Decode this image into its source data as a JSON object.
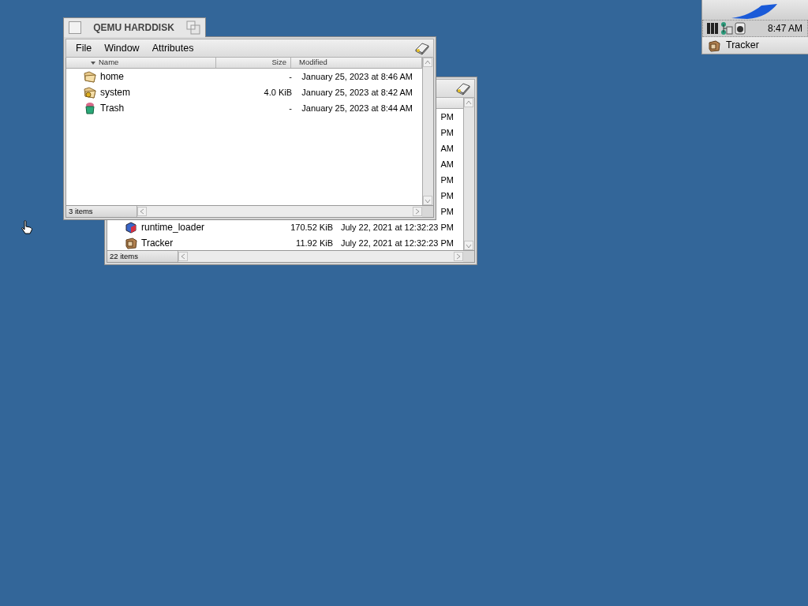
{
  "deskbar": {
    "clock": "8:47 AM",
    "apps": [
      {
        "label": "Tracker",
        "kind": "tracker"
      }
    ]
  },
  "back_window": {
    "rows": [
      {
        "modified": "PM"
      },
      {
        "modified": "PM"
      },
      {
        "modified": "AM"
      },
      {
        "modified": "AM"
      },
      {
        "modified": "PM"
      },
      {
        "modified": "PM"
      },
      {
        "modified": "PM"
      },
      {
        "name": "runtime_loader",
        "size": "170.52 KiB",
        "modified": "July 22, 2021 at 12:32:23 PM",
        "kind": "app"
      },
      {
        "name": "Tracker",
        "size": "11.92 KiB",
        "modified": "July 22, 2021 at 12:32:23 PM",
        "kind": "tracker"
      }
    ],
    "status": "22 items"
  },
  "front_window": {
    "title": "QEMU HARDDISK",
    "menu": [
      "File",
      "Window",
      "Attributes"
    ],
    "columns": [
      {
        "label": "Name",
        "sorted": true
      },
      {
        "label": "Size",
        "sorted": false
      },
      {
        "label": "Modified",
        "sorted": false
      }
    ],
    "rows": [
      {
        "name": "home",
        "size": "-",
        "modified": "January 25, 2023 at 8:46 AM",
        "kind": "folder"
      },
      {
        "name": "system",
        "size": "4.0 KiB",
        "modified": "January 25, 2023 at 8:42 AM",
        "kind": "system"
      },
      {
        "name": "Trash",
        "size": "-",
        "modified": "January 25, 2023 at 8:44 AM",
        "kind": "trash"
      }
    ],
    "status": "3 items"
  }
}
